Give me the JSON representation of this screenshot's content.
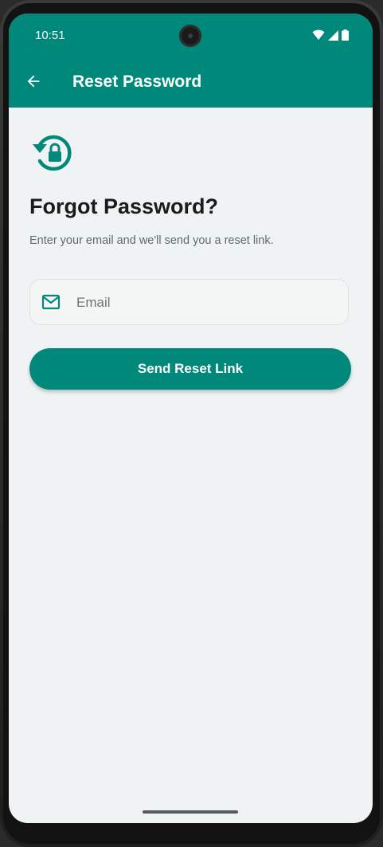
{
  "status_bar": {
    "time": "10:51",
    "icons": [
      "wifi-icon",
      "signal-icon",
      "battery-icon"
    ]
  },
  "app_bar": {
    "back_icon": "arrow-back-icon",
    "title": "Reset Password"
  },
  "content": {
    "header_icon": "lock-reset-icon",
    "heading": "Forgot Password?",
    "subtext": "Enter your email and we'll send you a reset link.",
    "email_field": {
      "icon": "mail-icon",
      "placeholder": "Email",
      "value": ""
    },
    "send_button_label": "Send Reset Link"
  },
  "colors": {
    "primary": "#00897b",
    "background": "#eff3f3",
    "text_primary": "#1a1c1c",
    "text_secondary": "#5f6b6b"
  }
}
